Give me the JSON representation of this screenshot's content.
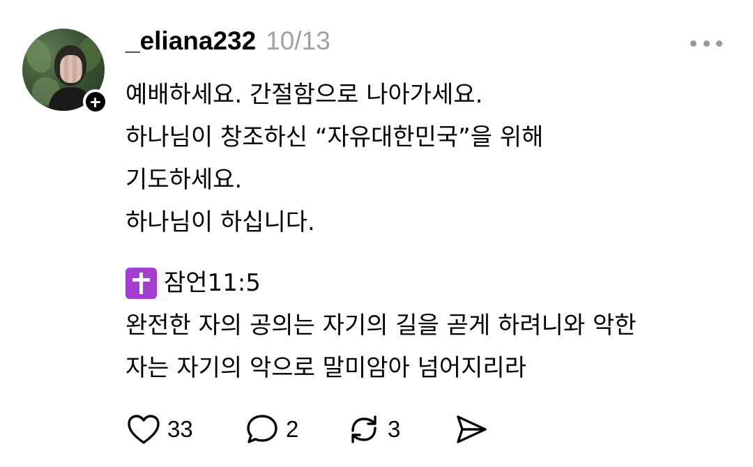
{
  "post": {
    "username": "_eliana232",
    "timestamp": "10/13",
    "lines": [
      "예배하세요. 간절함으로 나아가세요.",
      "하나님이 창조하신 “자유대한민국”을 위해",
      "기도하세요.",
      "하나님이 하십니다."
    ],
    "verse_reference": "잠언11:5",
    "verse_lines": [
      "완전한 자의 공의는 자기의 길을 곧게 하려니와 악한",
      "자는 자기의 악으로 말미암아 넘어지리라"
    ]
  },
  "actions": {
    "likes": "33",
    "replies": "2",
    "reposts": "3"
  },
  "icons": {
    "avatar_badge": "plus-icon",
    "more": "more-horizontal-icon",
    "verse": "latin-cross-emoji",
    "like": "heart-icon",
    "reply": "comment-bubble-icon",
    "repost": "repost-arrows-icon",
    "share": "send-icon"
  },
  "colors": {
    "timestamp": "#a0a0a0",
    "more_icon": "#9a9a9a",
    "cross_emoji_bg": "#a23fd1",
    "text": "#000000"
  }
}
